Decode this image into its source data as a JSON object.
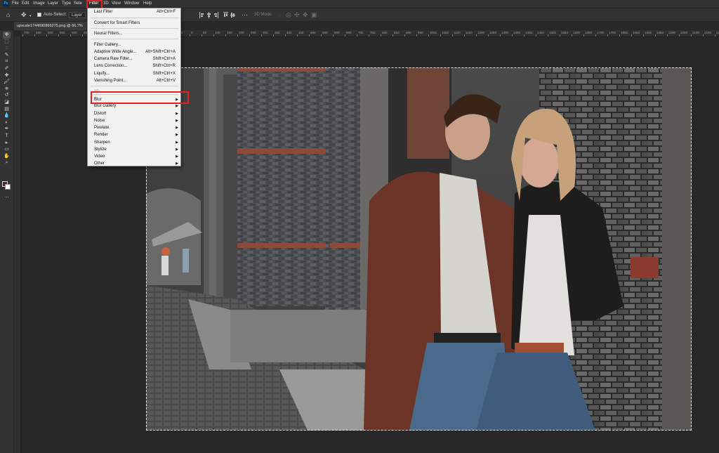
{
  "app": {
    "logo_text": "Ps"
  },
  "menubar": {
    "items": [
      "File",
      "Edit",
      "Image",
      "Layer",
      "Type",
      "Sele",
      "Filter",
      "3D",
      "View",
      "Window",
      "Help"
    ]
  },
  "options_bar": {
    "auto_select_label": "Auto-Select:",
    "layer_dropdown": "Layer",
    "mode_3d_label": "3D Mode:"
  },
  "document": {
    "tab_title": "upscale1744690866275.png @ 66.7%"
  },
  "ruler_ticks": [
    "700",
    "650",
    "600",
    "550",
    "500",
    "450",
    "400",
    "350",
    "300",
    "250",
    "200",
    "150",
    "100",
    "50",
    "0",
    "50",
    "100",
    "150",
    "200",
    "250",
    "300",
    "350",
    "400",
    "450",
    "500",
    "550",
    "600",
    "650",
    "700",
    "750",
    "800",
    "850",
    "900",
    "950",
    "1000",
    "1050",
    "1100",
    "1150",
    "1200",
    "1250",
    "1300",
    "1350",
    "1400",
    "1450",
    "1500",
    "1550",
    "1600",
    "1650",
    "1700",
    "1750",
    "1800",
    "1850",
    "1900",
    "1950",
    "2000",
    "2050",
    "2100",
    "2150",
    "2200"
  ],
  "filter_menu": {
    "items": [
      {
        "label": "Last Filter",
        "shortcut": "Alt+Ctrl+F",
        "disabled": false
      },
      {
        "label": "Convert for Smart Filters",
        "shortcut": "",
        "disabled": false
      },
      {
        "label": "Neural Filters...",
        "shortcut": "",
        "disabled": false
      },
      {
        "label": "Filter Gallery...",
        "shortcut": "",
        "disabled": false
      },
      {
        "label": "Adaptive Wide Angle...",
        "shortcut": "Alt+Shift+Ctrl+A",
        "disabled": false
      },
      {
        "label": "Camera Raw Filter...",
        "shortcut": "Shift+Ctrl+A",
        "disabled": false
      },
      {
        "label": "Lens Correction...",
        "shortcut": "Shift+Ctrl+R",
        "disabled": false
      },
      {
        "label": "Liquify...",
        "shortcut": "Shift+Ctrl+X",
        "disabled": false
      },
      {
        "label": "Vanishing Point...",
        "shortcut": "Alt+Ctrl+V",
        "disabled": false
      },
      {
        "label": "3D",
        "shortcut": "",
        "disabled": true
      },
      {
        "label": "Blur",
        "shortcut": "",
        "disabled": false
      },
      {
        "label": "Blur Gallery",
        "shortcut": "",
        "disabled": false
      },
      {
        "label": "Distort",
        "shortcut": "",
        "disabled": false
      },
      {
        "label": "Noise",
        "shortcut": "",
        "disabled": false
      },
      {
        "label": "Pixelate",
        "shortcut": "",
        "disabled": false
      },
      {
        "label": "Render",
        "shortcut": "",
        "disabled": false
      },
      {
        "label": "Sharpen",
        "shortcut": "",
        "disabled": false
      },
      {
        "label": "Stylize",
        "shortcut": "",
        "disabled": false
      },
      {
        "label": "Video",
        "shortcut": "",
        "disabled": false
      },
      {
        "label": "Other",
        "shortcut": "",
        "disabled": false
      }
    ]
  },
  "tools": [
    "move-tool-icon",
    "marquee-tool-icon",
    "lasso-tool-icon",
    "quick-select-tool-icon",
    "crop-tool-icon",
    "eyedropper-tool-icon",
    "healing-brush-tool-icon",
    "brush-tool-icon",
    "clone-stamp-tool-icon",
    "history-brush-tool-icon",
    "eraser-tool-icon",
    "gradient-tool-icon",
    "blur-tool-icon",
    "dodge-tool-icon",
    "pen-tool-icon",
    "type-tool-icon",
    "path-select-tool-icon",
    "rectangle-tool-icon",
    "hand-tool-icon",
    "zoom-tool-icon",
    "more-tools-icon"
  ],
  "colors": {
    "highlight": "#e02222",
    "panel": "#323232",
    "canvas_bg": "#282828",
    "menu_bg": "#f1f1f1"
  }
}
